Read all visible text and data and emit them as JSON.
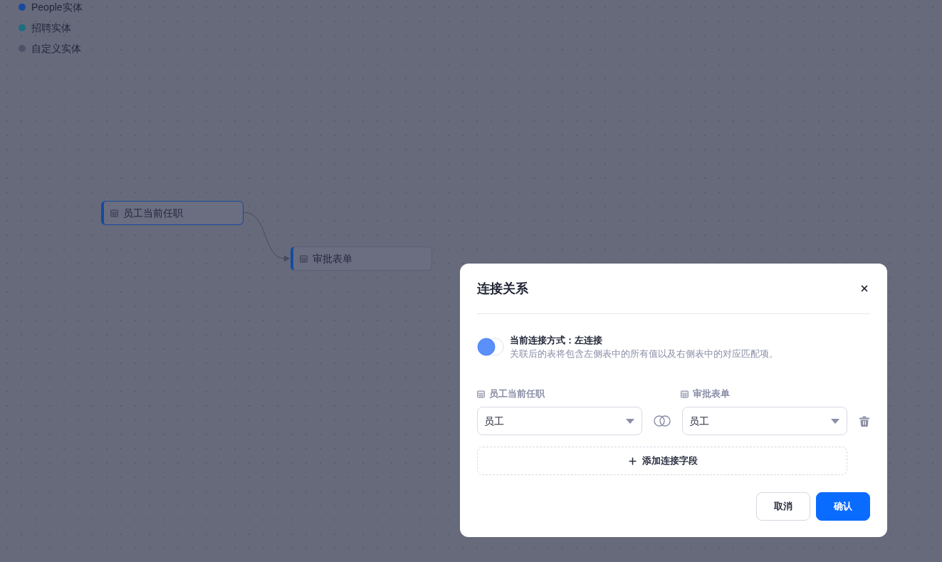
{
  "legend": [
    {
      "label": "People实体",
      "color": "#174a9e"
    },
    {
      "label": "招聘实体",
      "color": "#1b6f80"
    },
    {
      "label": "自定义实体",
      "color": "#4e5269"
    }
  ],
  "canvas": {
    "nodes": [
      {
        "label": "员工当前任职",
        "selected": true
      },
      {
        "label": "审批表单",
        "selected": false
      }
    ]
  },
  "dialog": {
    "title": "连接关系",
    "join": {
      "kind": "left",
      "title": "当前连接方式：左连接",
      "description": "关联后的表将包含左侧表中的所有值以及右侧表中的对应匹配项。"
    },
    "fields": {
      "left_table": "员工当前任职",
      "right_table": "审批表单",
      "rows": [
        {
          "left": "员工",
          "right": "员工"
        }
      ]
    },
    "add_button": "添加连接字段",
    "buttons": [
      {
        "label": "取消",
        "kind": "secondary"
      },
      {
        "label": "确认",
        "kind": "primary"
      }
    ]
  }
}
